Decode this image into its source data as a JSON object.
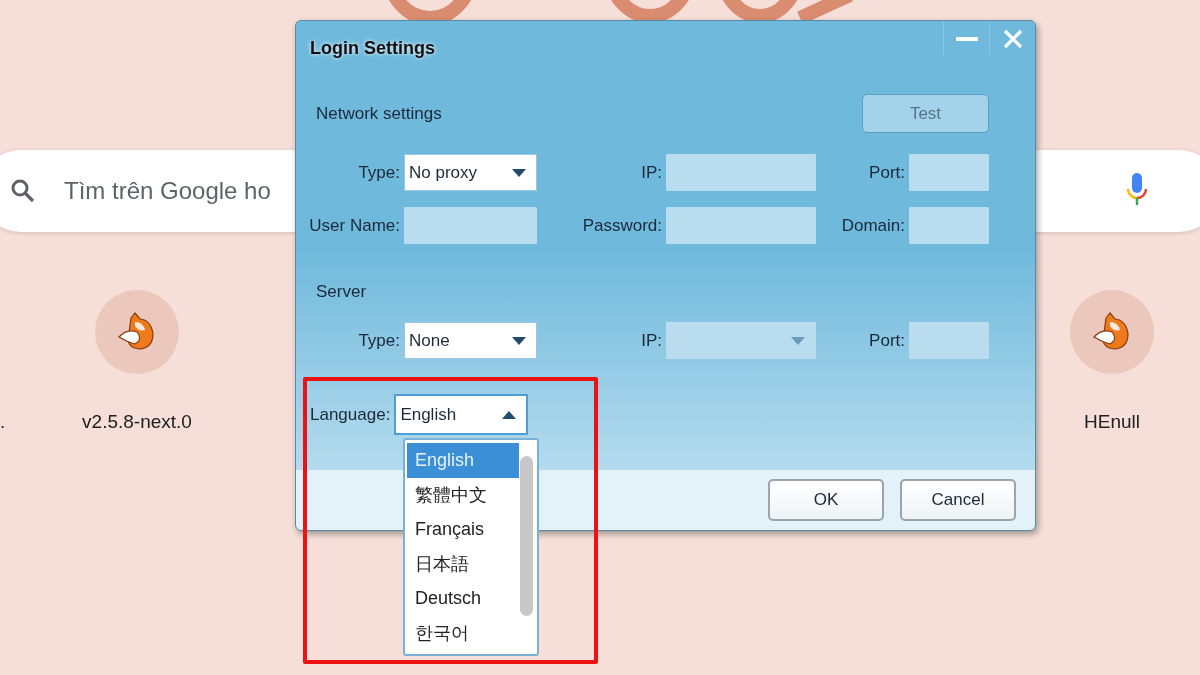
{
  "browser_page": {
    "search": {
      "placeholder": "Tìm trên Google ho"
    },
    "edge_label": ".",
    "shortcuts": [
      {
        "label": "v2.5.8-next.0"
      },
      {
        "label": "HEnull"
      }
    ]
  },
  "dialog": {
    "title": "Login Settings",
    "network": {
      "heading": "Network settings",
      "test_button": {
        "label": "Test",
        "disabled": true
      },
      "fields": [
        {
          "label": "Type:",
          "kind": "select",
          "value": "No proxy",
          "disabled": false
        },
        {
          "label": "IP:",
          "kind": "text",
          "disabled": true
        },
        {
          "label": "Port:",
          "kind": "text",
          "disabled": true
        },
        {
          "label": "User Name:",
          "kind": "text",
          "disabled": true
        },
        {
          "label": "Password:",
          "kind": "text",
          "disabled": true
        },
        {
          "label": "Domain:",
          "kind": "text",
          "disabled": true
        }
      ]
    },
    "server": {
      "heading": "Server",
      "fields": [
        {
          "label": "Type:",
          "kind": "select",
          "value": "None",
          "disabled": false
        },
        {
          "label": "IP:",
          "kind": "select",
          "disabled": true
        },
        {
          "label": "Port:",
          "kind": "text",
          "disabled": true
        }
      ]
    },
    "language": {
      "label": "Language:",
      "value": "English",
      "expanded": true,
      "options": [
        {
          "label": "English",
          "selected": true
        },
        {
          "label": "繁體中文",
          "selected": false
        },
        {
          "label": "Français",
          "selected": false
        },
        {
          "label": "日本語",
          "selected": false
        },
        {
          "label": "Deutsch",
          "selected": false
        },
        {
          "label": "한국어",
          "selected": false
        }
      ]
    },
    "buttons": [
      "OK",
      "Cancel"
    ]
  }
}
